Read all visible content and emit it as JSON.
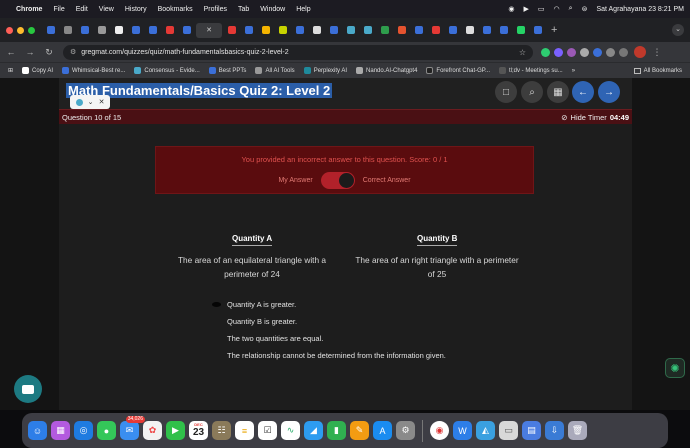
{
  "menubar": {
    "app": "Chrome",
    "menus": [
      "File",
      "Edit",
      "View",
      "History",
      "Bookmarks",
      "Profiles",
      "Tab",
      "Window",
      "Help"
    ],
    "datetime": "Sat Agrahayana 23  8:21 PM"
  },
  "browser": {
    "url": "gregmat.com/quizzes/quiz/math-fundamentalsbasics-quiz-2-level-2",
    "bookmarks": [
      "Copy AI",
      "Whimsical-Best re...",
      "Consensus - Evide...",
      "Best PPTs",
      "All AI Tools",
      "Perplexity AI",
      "Nando.AI-Chatgpt4",
      "Forefront Chat-GP...",
      "tl;dv - Meetings su..."
    ],
    "all_bookmarks": "All Bookmarks"
  },
  "quiz": {
    "title": "Math Fundamentals/Basics Quiz 2: Level 2",
    "question_label": "Question 10 of 15",
    "hide_timer": "Hide Timer",
    "timer": "04:49",
    "feedback": "You provided an incorrect answer to this question. Score: 0 / 1",
    "my_answer": "My Answer",
    "correct_answer": "Correct Answer",
    "quantity_a_label": "Quantity A",
    "quantity_b_label": "Quantity B",
    "quantity_a_text": "The area of an equilateral triangle with a perimeter of 24",
    "quantity_b_text": "The area of an right triangle with a perimeter of 25",
    "choices": [
      "Quantity A is greater.",
      "Quantity B is greater.",
      "The two quantities are equal.",
      "The relationship cannot be determined from the information given."
    ]
  },
  "dock": {
    "mail_badge": "34,026",
    "calendar_day": "23"
  }
}
